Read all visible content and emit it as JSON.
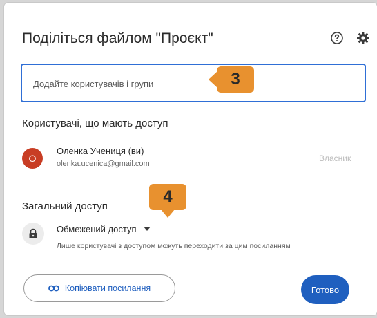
{
  "dialog": {
    "title": "Поділіться файлом \"Проєкт\"",
    "help_icon": "help-circle-icon",
    "settings_icon": "gear-icon"
  },
  "share_input": {
    "placeholder": "Додайте користувачів і групи"
  },
  "annotations": {
    "step_a": "3",
    "step_b": "4"
  },
  "users_section": {
    "title": "Користувачі, що мають доступ",
    "users": [
      {
        "avatar_letter": "О",
        "name": "Оленка Учениця (ви)",
        "email": "olenka.ucenica@gmail.com",
        "role": "Власник"
      }
    ]
  },
  "general_access": {
    "title": "Загальний доступ",
    "icon": "lock-icon",
    "selected": "Обмежений доступ",
    "description": "Лише користувачі з доступом можуть переходити за цим посиланням"
  },
  "footer": {
    "copy_link_label": "Копіювати посилання",
    "copy_icon": "link-icon",
    "done_label": "Готово"
  },
  "colors": {
    "accent": "#1f5fbf",
    "input_border": "#2f6fd6",
    "badge": "#e8912f",
    "avatar": "#c83d24"
  }
}
